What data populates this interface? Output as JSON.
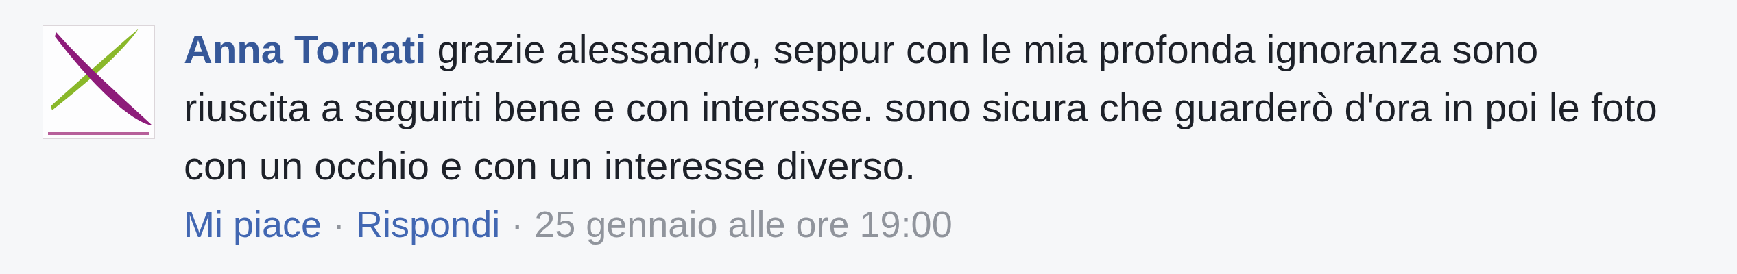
{
  "comment": {
    "author": "Anna Tornati",
    "text": "grazie alessandro, seppur con le mia profonda ignoranza sono riuscita a seguirti bene e con interesse. sono sicura che guarderò d'ora in poi le foto con un occhio e con un interesse diverso.",
    "meta": [
      {
        "kind": "link",
        "text": "Mi piace"
      },
      {
        "kind": "separator",
        "text": "·"
      },
      {
        "kind": "link",
        "text": "Rispondi"
      },
      {
        "kind": "separator",
        "text": "·"
      },
      {
        "kind": "time",
        "text": "25 gennaio alle ore 19:00"
      }
    ]
  }
}
